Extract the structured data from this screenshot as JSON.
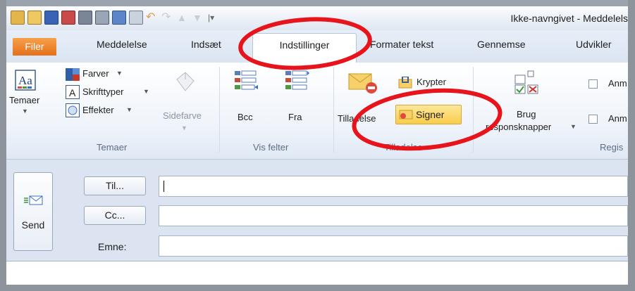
{
  "window": {
    "title": "Ikke-navngivet - Meddelels"
  },
  "tabs": {
    "file": "Filer",
    "message": "Meddelelse",
    "insert": "Indsæt",
    "options": "Indstillinger",
    "format_text": "Formater tekst",
    "review": "Gennemse",
    "developer": "Udvikler"
  },
  "ribbon": {
    "themes": {
      "themes_label": "Temaer",
      "colors_label": "Farver",
      "fonts_label": "Skrifttyper",
      "effects_label": "Effekter",
      "page_color_label": "Sidefarve",
      "group_label": "Temaer"
    },
    "show_fields": {
      "bcc_label": "Bcc",
      "from_label": "Fra",
      "group_label": "Vis felter"
    },
    "permission": {
      "permission_label": "Tilladelse",
      "encrypt_label": "Krypter",
      "sign_label": "Signer",
      "group_label": "Tilladelse"
    },
    "tracking": {
      "voting_label_1": "Brug",
      "voting_label_2": "responsknapper",
      "request_1_label": "Anm",
      "request_2_label": "Anm",
      "group_label": "Regis"
    }
  },
  "compose": {
    "send_label": "Send",
    "to_label": "Til...",
    "cc_label": "Cc...",
    "subject_label": "Emne:",
    "to_value": "",
    "cc_value": "",
    "subject_value": ""
  },
  "colors": {
    "annotation_red": "#e8141b",
    "file_tab_orange": "#e5701a",
    "sign_highlight": "#fbd75a"
  }
}
